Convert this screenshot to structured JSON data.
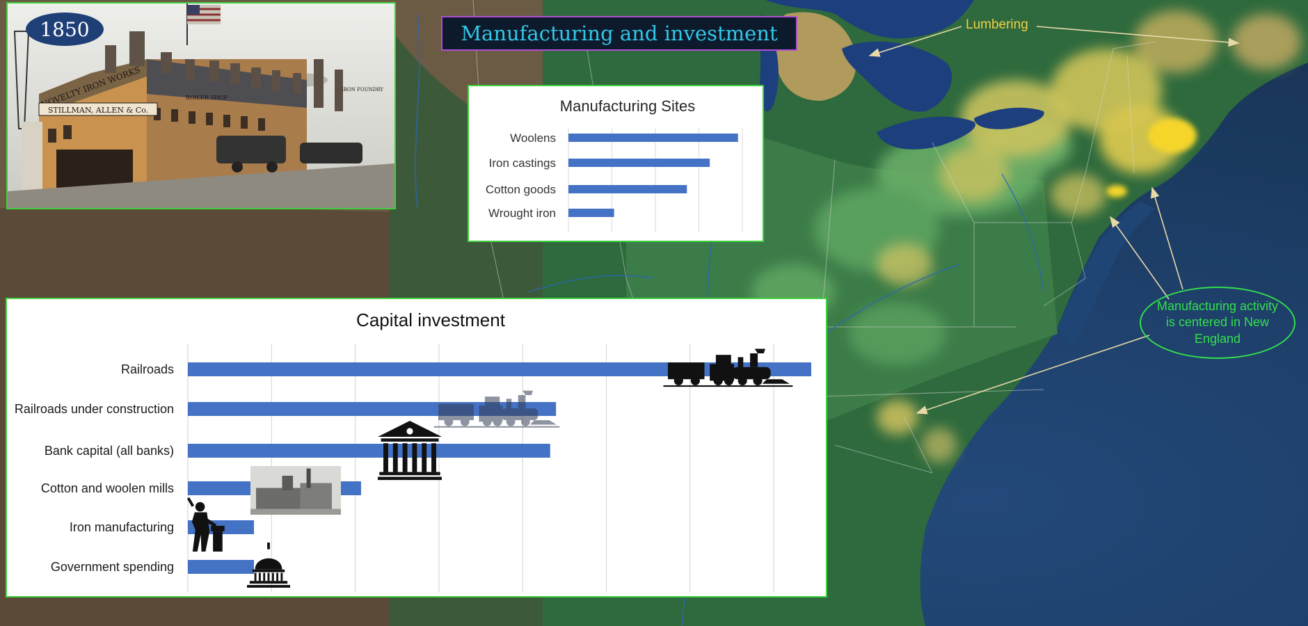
{
  "header": {
    "title": "Manufacturing and investment",
    "year": "1850"
  },
  "engraving": {
    "sign_main": "NOVELTY IRON WORKS",
    "sign_company": "STILLMAN, ALLEN & Co.",
    "sign_foundry": "IRON FOUNDRY",
    "sign_boiler": "BOILER SHOP"
  },
  "map": {
    "lumbering_label": "Lumbering",
    "callout_text": "Manufacturing activity is centered in New England",
    "colors": {
      "water": "#1c3d63",
      "land_green": "#2f6a3a",
      "highlight_yellow": "#f4d03f"
    }
  },
  "chart_data": [
    {
      "type": "bar",
      "orientation": "horizontal",
      "title": "Manufacturing Sites",
      "categories": [
        "Woolens",
        "Iron castings",
        "Cotton goods",
        "Wrought iron"
      ],
      "values": [
        1560,
        1300,
        1090,
        420
      ],
      "xlim": [
        0,
        1600
      ],
      "grid": true,
      "bar_color": "#4472c4"
    },
    {
      "type": "bar",
      "orientation": "horizontal",
      "title": "Capital investment",
      "categories": [
        "Railroads",
        "Railroads under construction",
        "Bank capital (all banks)",
        "Cotton and woolen mills",
        "Iron manufacturing",
        "Government spending"
      ],
      "values": [
        745,
        440,
        433,
        207,
        79,
        79
      ],
      "xlim": [
        0,
        750
      ],
      "grid": true,
      "bar_color": "#4472c4",
      "icons": [
        "locomotive-icon",
        "locomotive-icon",
        "bank-icon",
        "mill-icon",
        "blacksmith-icon",
        "capitol-icon"
      ]
    }
  ]
}
